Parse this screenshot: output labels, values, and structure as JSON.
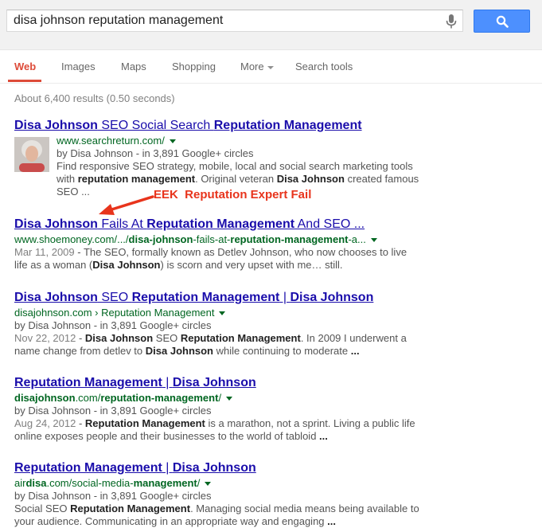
{
  "search": {
    "query": "disa johnson reputation management"
  },
  "tabs": [
    {
      "label": "Web"
    },
    {
      "label": "Images"
    },
    {
      "label": "Maps"
    },
    {
      "label": "Shopping"
    },
    {
      "label": "More"
    },
    {
      "label": "Search tools"
    }
  ],
  "stats": "About 6,400 results (0.50 seconds)",
  "annotation": "EEK  Reputation Expert Fail",
  "colors": {
    "link": "#1a0dab",
    "url_green": "#006621",
    "active_tab": "#dd4b39",
    "search_button": "#4d90fe",
    "annotation_red": "#e8341c"
  },
  "results": [
    {
      "title": [
        "Disa Johnson",
        " SEO Social Search ",
        "Reputation Management"
      ],
      "url": [
        "www.searchreturn.com/"
      ],
      "meta": "by Disa Johnson - in 3,891 Google+ circles",
      "snippet": [
        "Find responsive SEO strategy, mobile, local and social search marketing tools",
        "with ",
        "reputation management",
        ". Original veteran ",
        "Disa Johnson",
        " created famous",
        "SEO ..."
      ]
    },
    {
      "title": [
        "Disa Johnson",
        " Fails At ",
        "Reputation Management",
        " And SEO ..."
      ],
      "url": [
        "www.shoemoney.com/.../",
        "disa-johnson",
        "-fails-at-",
        "reputation-management",
        "-a..."
      ],
      "date": "Mar 11, 2009",
      "snippet": [
        " - The SEO, formally known as Detlev Johnson, who now chooses to live",
        "life as a woman (",
        "Disa Johnson",
        ") is scorn and very upset with me… still."
      ]
    },
    {
      "title": [
        "Disa Johnson",
        " SEO ",
        "Reputation Management",
        " | ",
        "Disa Johnson"
      ],
      "url": [
        "disajohnson.com › Reputation Management"
      ],
      "meta": "by Disa Johnson - in 3,891 Google+ circles",
      "date": "Nov 22, 2012",
      "snippet": [
        " - ",
        "Disa Johnson",
        " SEO ",
        "Reputation Management",
        ". In 2009 I underwent a",
        "name change from detlev to ",
        "Disa Johnson",
        " while continuing to moderate ",
        "..."
      ]
    },
    {
      "title": [
        "Reputation Management",
        " | ",
        "Disa Johnson"
      ],
      "url": [
        "disajohnson",
        ".com/",
        "reputation-management",
        "/"
      ],
      "meta": "by Disa Johnson - in 3,891 Google+ circles",
      "date": "Aug 24, 2012",
      "snippet": [
        " - ",
        "Reputation Management",
        " is a marathon, not a sprint. Living a public life",
        "online exposes people and their businesses to the world of tabloid ",
        "..."
      ]
    },
    {
      "title": [
        "Reputation Management",
        " | ",
        "Disa Johnson"
      ],
      "url": [
        "air",
        "disa",
        ".com/social-media-",
        "management",
        "/"
      ],
      "meta": "by Disa Johnson - in 3,891 Google+ circles",
      "snippet": [
        "Social SEO ",
        "Reputation Management",
        ". Managing social media means being available to",
        "your audience. Communicating in an appropriate way and engaging ",
        "..."
      ]
    }
  ]
}
